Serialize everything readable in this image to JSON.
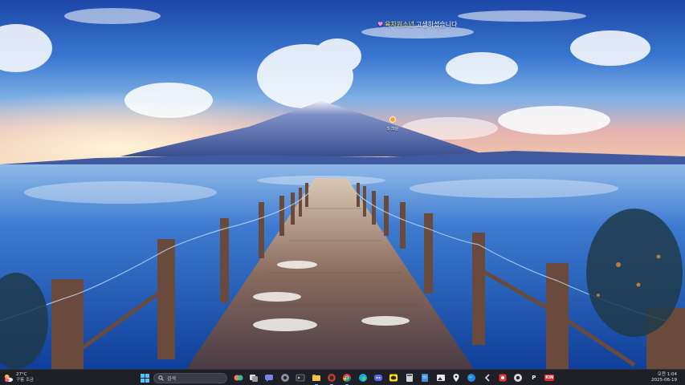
{
  "desktop": {
    "notice": {
      "prefix": "육차원소년",
      "suffix": " 고생하셨습니다"
    },
    "map_pin": {
      "label": "5 크실"
    }
  },
  "taskbar": {
    "weather": {
      "temp": "27°C",
      "desc": "구름 조금"
    },
    "search": {
      "placeholder": "검색"
    },
    "apps": [
      {
        "name": "widgets-icon"
      },
      {
        "name": "task-view-icon"
      },
      {
        "name": "chat-icon"
      },
      {
        "name": "settings-icon"
      },
      {
        "name": "terminal-icon"
      },
      {
        "name": "file-explorer-icon"
      },
      {
        "name": "game-icon"
      },
      {
        "name": "chrome-icon"
      },
      {
        "name": "edge-icon"
      },
      {
        "name": "discord-icon"
      },
      {
        "name": "kakaotalk-icon"
      },
      {
        "name": "calculator-icon"
      },
      {
        "name": "document-icon"
      },
      {
        "name": "photos-icon"
      },
      {
        "name": "maps-icon"
      },
      {
        "name": "earth-icon"
      },
      {
        "name": "back-app-icon"
      },
      {
        "name": "red-app-icon"
      },
      {
        "name": "circle-app-icon"
      },
      {
        "name": "p-app-icon"
      },
      {
        "name": "kin-app-icon"
      }
    ],
    "p_app_label": "P",
    "kin_app_label": "KIN",
    "clock": {
      "time": "오전 1:04",
      "date": "2025-06-19"
    }
  },
  "colors": {
    "taskbar_bg": "#1f2027",
    "accent": "#7aa8ff",
    "notice_highlight": "#ffe36b"
  }
}
